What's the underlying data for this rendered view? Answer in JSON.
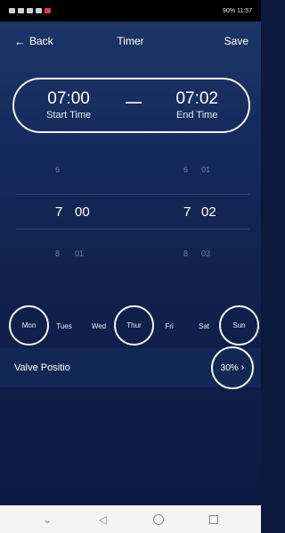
{
  "status_bar": {
    "left_text": "",
    "right_text": "90% 11:57"
  },
  "header": {
    "back_label": "Back",
    "title": "Timer",
    "save_label": "Save"
  },
  "time_range": {
    "start_time": "07:00",
    "start_label": "Start Time",
    "end_time": "07:02",
    "end_label": "End Time"
  },
  "picker": {
    "rows": [
      {
        "start_hour": "6",
        "start_min": "",
        "end_hour": "6",
        "end_min": "01"
      },
      {
        "start_hour": "7",
        "start_min": "00",
        "end_hour": "7",
        "end_min": "02"
      },
      {
        "start_hour": "8",
        "start_min": "01",
        "end_hour": "8",
        "end_min": "03"
      }
    ]
  },
  "days": [
    {
      "label": "Mon",
      "selected": true
    },
    {
      "label": "Tues",
      "selected": false
    },
    {
      "label": "Wed",
      "selected": false
    },
    {
      "label": "Thur",
      "selected": true
    },
    {
      "label": "Fri",
      "selected": false
    },
    {
      "label": "Sat",
      "selected": false
    },
    {
      "label": "Sun",
      "selected": true
    }
  ],
  "valve": {
    "label": "Valve Positio",
    "value": "30%"
  },
  "nav": {
    "back_icon": "triangle-back-icon",
    "home_icon": "circle-home-icon",
    "recents_icon": "square-recents-icon",
    "down_icon": "chevron-down-icon"
  },
  "colors": {
    "background": "#15295a",
    "accent_outline": "#f2f4f8",
    "muted_text": "#6f7fa5"
  }
}
